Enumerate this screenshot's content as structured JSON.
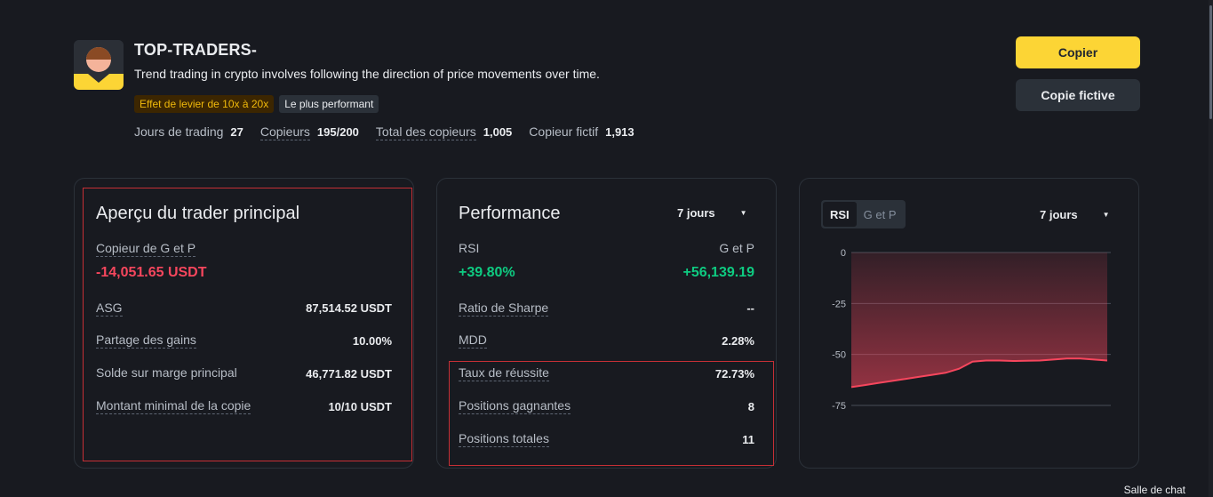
{
  "header": {
    "name": "TOP-TRADERS-",
    "description": "Trend trading in crypto involves following the direction of price movements over time.",
    "tags": [
      "Effet de levier de 10x à 20x",
      "Le plus performant"
    ],
    "stats": [
      {
        "label": "Jours de trading",
        "value": "27"
      },
      {
        "label": "Copieurs",
        "value": "195/200"
      },
      {
        "label": "Total des copieurs",
        "value": "1,005"
      },
      {
        "label": "Copieur fictif",
        "value": "1,913"
      }
    ],
    "copy_button": "Copier",
    "mock_button": "Copie fictive"
  },
  "overview": {
    "title": "Aperçu du trader principal",
    "pnl_label": "Copieur de G et P",
    "pnl_value": "-14,051.65 USDT",
    "rows": [
      {
        "label": "ASG",
        "value": "87,514.52 USDT"
      },
      {
        "label": "Partage des gains",
        "value": "10.00%"
      },
      {
        "label": "Solde sur marge principal",
        "value": "46,771.82 USDT"
      },
      {
        "label": "Montant minimal de la copie",
        "value": "10/10 USDT"
      }
    ]
  },
  "performance": {
    "title": "Performance",
    "period": "7 jours",
    "rsi_label": "RSI",
    "rsi_value": "+39.80%",
    "pnl_label": "G et P",
    "pnl_value": "+56,139.19",
    "rows": [
      {
        "label": "Ratio de Sharpe",
        "value": "--"
      },
      {
        "label": "MDD",
        "value": "2.28%"
      },
      {
        "label": "Taux de réussite",
        "value": "72.73%"
      },
      {
        "label": "Positions gagnantes",
        "value": "8"
      },
      {
        "label": "Positions totales",
        "value": "11"
      }
    ]
  },
  "chart_panel": {
    "tabs": [
      "RSI",
      "G et P"
    ],
    "active_tab": "RSI",
    "period": "7 jours"
  },
  "chart_data": {
    "type": "area",
    "title": "",
    "xlabel": "",
    "ylabel": "",
    "ylim": [
      -75,
      0
    ],
    "yticks": [
      "0",
      "-25",
      "-50",
      "-75"
    ],
    "ytick_values": [
      0,
      -25,
      -50,
      -75
    ],
    "series": [
      {
        "values": [
          -66,
          -65,
          -64,
          -63,
          -62,
          -61,
          -60,
          -59,
          -57,
          -53.5,
          -53,
          -53,
          -53.2,
          -53.1,
          -53,
          -52.5,
          -52,
          -52,
          -52.5,
          -53
        ]
      }
    ],
    "color": "#f6465d",
    "grid": true
  },
  "footer": {
    "chat_label": "Salle de chat"
  }
}
